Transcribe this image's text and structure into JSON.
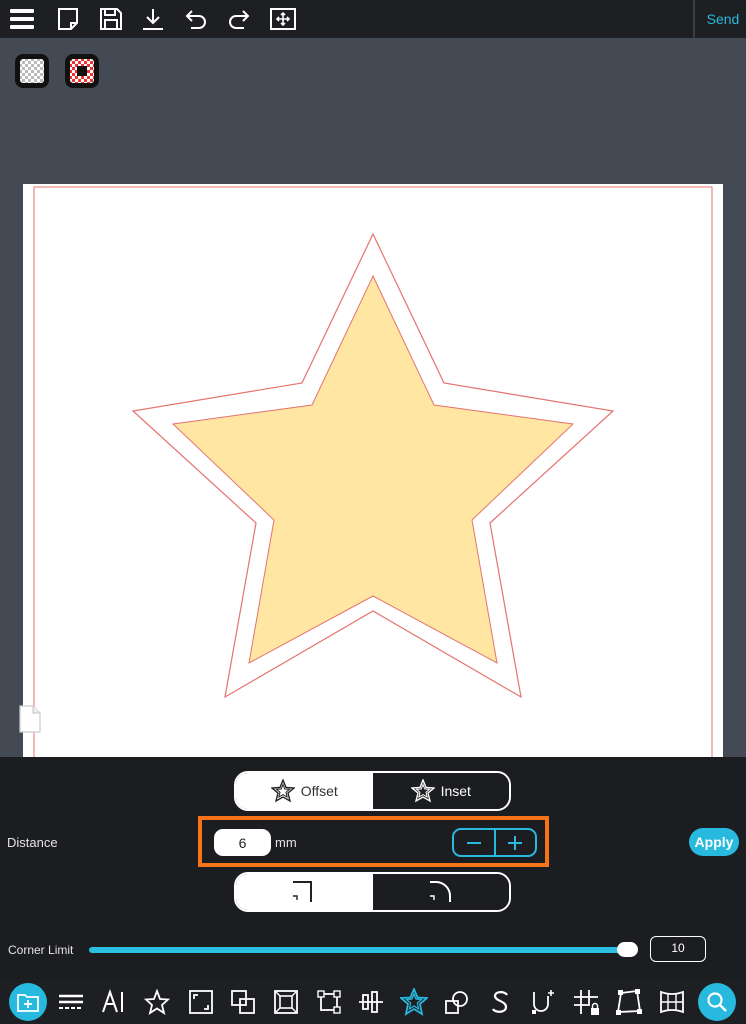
{
  "toolbar": {
    "send_label": "Send",
    "icons": [
      "menu-icon",
      "new-page-icon",
      "save-icon",
      "download-icon",
      "undo-icon",
      "redo-icon",
      "fit-view-icon"
    ]
  },
  "panel": {
    "offset_label": "Offset",
    "inset_label": "Inset",
    "distance_label": "Distance",
    "distance_value": "6",
    "distance_unit": "mm",
    "apply_label": "Apply",
    "corner_limit_label": "Corner Limit",
    "corner_limit_value": "10",
    "corner_limit_fraction": 0.98
  },
  "colors": {
    "accent": "#27b9de",
    "highlight": "#f7731a",
    "star_fill": "#ffe6a3",
    "cut_line": "#e5736f"
  }
}
